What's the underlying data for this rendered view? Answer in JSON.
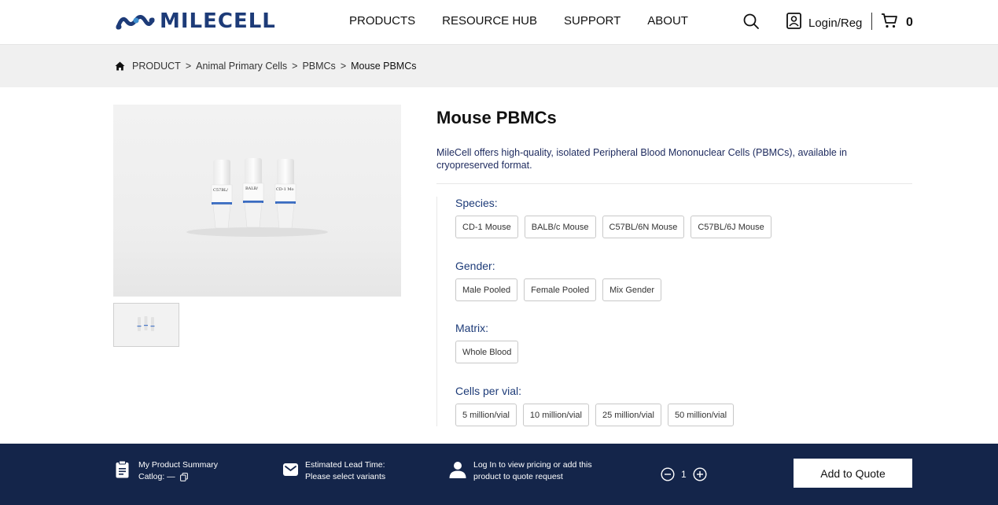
{
  "header": {
    "logo_text": "MILECELL",
    "nav": [
      "PRODUCTS",
      "RESOURCE HUB",
      "SUPPORT",
      "ABOUT"
    ],
    "login_label": "Login/Reg",
    "cart_count": "0"
  },
  "breadcrumb": [
    "PRODUCT",
    "Animal Primary Cells",
    "PBMCs",
    "Mouse PBMCs"
  ],
  "product": {
    "title": "Mouse PBMCs",
    "description": "MileCell offers high-quality, isolated Peripheral Blood Mononuclear Cells (PBMCs), available in  cryopreserved format.",
    "vial_labels": [
      "C57BL/",
      "BALB/",
      "CD-1 Mo"
    ]
  },
  "options": {
    "species": {
      "label": "Species:",
      "choices": [
        "CD-1 Mouse",
        "BALB/c Mouse",
        "C57BL/6N Mouse",
        "C57BL/6J Mouse"
      ]
    },
    "gender": {
      "label": "Gender:",
      "choices": [
        "Male Pooled",
        "Female Pooled",
        "Mix Gender"
      ]
    },
    "matrix": {
      "label": "Matrix:",
      "choices": [
        "Whole Blood"
      ]
    },
    "cells": {
      "label": "Cells per vial:",
      "choices": [
        "5 million/vial",
        "10 million/vial",
        "25 million/vial",
        "50 million/vial"
      ]
    }
  },
  "bottom": {
    "summary_title": "My Product Summary",
    "summary_catalog": "Catlog: —",
    "lead_title": "Estimated Lead Time:",
    "lead_value": "Please select variants",
    "login_line1": "Log In to view pricing or add this",
    "login_line2": "product to quote request",
    "quantity": "1",
    "quote_label": "Add to Quote"
  },
  "colors": {
    "brand": "#1d3b78",
    "bottom_bar": "#14254a",
    "crumb_bg": "#f0f0f0"
  }
}
